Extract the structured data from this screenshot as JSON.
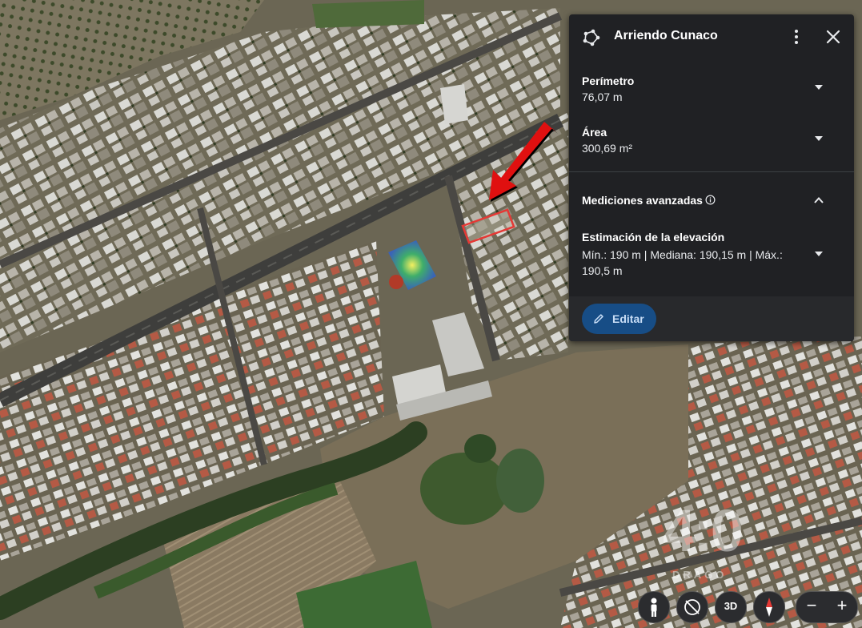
{
  "panel": {
    "title": "Arriendo Cunaco",
    "shape_icon": "polygon-icon",
    "more_icon": "more-vert-icon",
    "close_icon": "close-icon",
    "perimeter_label": "Perímetro",
    "perimeter_value": "76,07 m",
    "area_label": "Área",
    "area_value": "300,69 m²",
    "advanced_label": "Mediciones avanzadas",
    "elevation_label": "Estimación de la elevación",
    "elevation_value": "Mín.: 190 m | Mediana: 190,15 m | Máx.: 190,5 m",
    "edit_label": "Editar",
    "edit_icon": "pencil-icon"
  },
  "map": {
    "type": "satellite-imagery",
    "highlight_color": "#e53935",
    "arrow_color": "#e01010"
  },
  "controls": {
    "pegman_icon": "pegman-icon",
    "tilt_icon": "no-tilt-icon",
    "view_3d_label": "3D",
    "compass_icon": "compass-icon",
    "zoom_out_label": "−",
    "zoom_in_label": "+"
  },
  "watermark": {
    "text": "4:0",
    "sub": "DRAGO"
  }
}
